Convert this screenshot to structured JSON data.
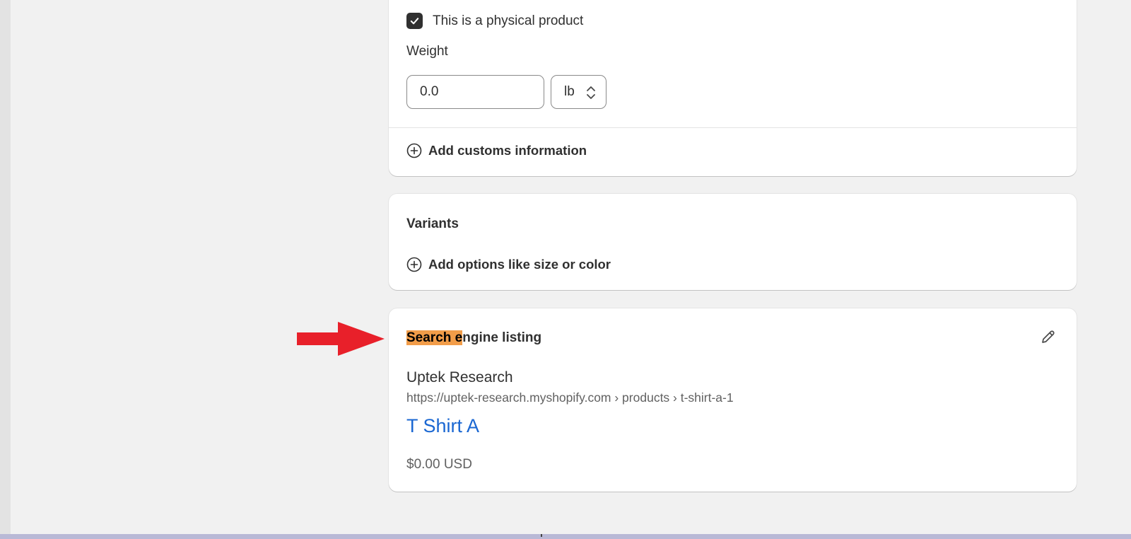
{
  "shipping": {
    "physical_product_label": "This is a physical product",
    "physical_product_checked": true,
    "weight_label": "Weight",
    "weight_value": "0.0",
    "weight_unit": "lb",
    "add_customs_label": "Add customs information"
  },
  "variants": {
    "title": "Variants",
    "add_options_label": "Add options like size or color"
  },
  "seo": {
    "title_highlight": "Search e",
    "title_rest": "ngine listing",
    "store_name": "Uptek Research",
    "url": "https://uptek-research.myshopify.com › products › t-shirt-a-1",
    "product_title": "T Shirt A",
    "price": "$0.00 USD"
  },
  "colors": {
    "highlight": "#f29d49",
    "arrow": "#e8202a",
    "link_blue": "#1a67d2"
  }
}
